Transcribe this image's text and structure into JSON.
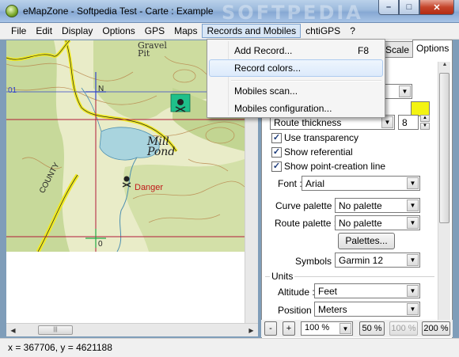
{
  "window": {
    "title": "eMapZone - Softpedia Test - Carte : Example",
    "watermark": "SOFTPEDIA",
    "controls": {
      "minimize": "–",
      "maximize": "□",
      "close": "✕"
    }
  },
  "menubar": {
    "items": [
      {
        "label": "File"
      },
      {
        "label": "Edit"
      },
      {
        "label": "Display"
      },
      {
        "label": "Options"
      },
      {
        "label": "GPS"
      },
      {
        "label": "Maps"
      },
      {
        "label": "Records and Mobiles"
      },
      {
        "label": "chtiGPS"
      },
      {
        "label": "?"
      }
    ]
  },
  "dropdown": {
    "items": [
      {
        "label": "Add Record...",
        "shortcut": "F8"
      },
      {
        "label": "Record colors..."
      },
      {
        "label": "Mobiles scan..."
      },
      {
        "label": "Mobiles configuration..."
      }
    ]
  },
  "map": {
    "labels": {
      "gravel_pit": "Gravel\nPit",
      "mill_pond": "Mill\nPond",
      "danger": "Danger",
      "county": "COUNTY",
      "grid_01": "01",
      "grid_n": "N",
      "grid_0": "0"
    }
  },
  "panel": {
    "tabs": [
      {
        "label": "Scale"
      },
      {
        "label": "Options"
      }
    ],
    "line_style_value": "Route thickness",
    "thickness_value": "8",
    "checkboxes": [
      {
        "label": "Use transparency",
        "checked": true
      },
      {
        "label": "Show referential",
        "checked": true
      },
      {
        "label": "Show point-creation line",
        "checked": true
      }
    ],
    "font_label": "Font :",
    "font_value": "Arial",
    "curve_palette_label": "Curve palette :",
    "curve_palette_value": "No palette",
    "route_palette_label": "Route palette :",
    "route_palette_value": "No palette",
    "palettes_button": "Palettes...",
    "symbols_label": "Symbols :",
    "symbols_value": "Garmin 12",
    "units_group": "Units",
    "altitude_label": "Altitude :",
    "altitude_value": "Feet",
    "position_label": "Position :",
    "position_value": "Meters",
    "swatch_color": "#f3f312"
  },
  "zoombar": {
    "minus": "-",
    "plus": "+",
    "zoom_value": "100 %",
    "z50": "50 %",
    "z100": "100 %",
    "z200": "200 %"
  },
  "statusbar": {
    "coords": "x = 367706, y = 4621188"
  }
}
